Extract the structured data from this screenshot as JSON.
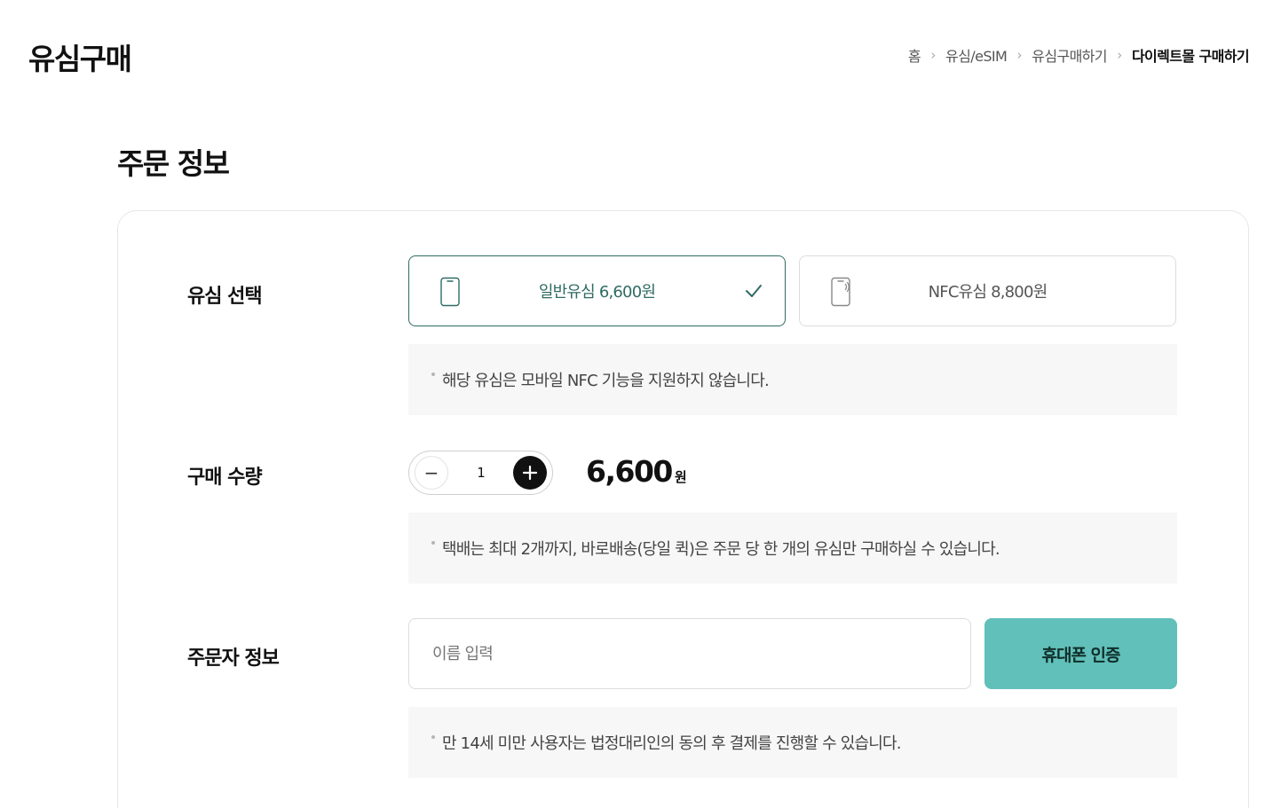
{
  "header": {
    "title": "유심구매"
  },
  "breadcrumb": {
    "items": [
      "홈",
      "유심/eSIM",
      "유심구매하기",
      "다이렉트몰 구매하기"
    ]
  },
  "section": {
    "title": "주문 정보"
  },
  "sim_selection": {
    "label": "유심 선택",
    "options": [
      {
        "label": "일반유심 6,600원",
        "selected": true,
        "icon": "phone-icon"
      },
      {
        "label": "NFC유심 8,800원",
        "selected": false,
        "icon": "nfc-phone-icon"
      }
    ],
    "notice": "해당 유심은 모바일 NFC 기능을 지원하지 않습니다."
  },
  "quantity": {
    "label": "구매 수량",
    "minus_label": "−",
    "value": "1",
    "price": "6,600",
    "unit": "원",
    "notice": "택배는 최대 2개까지, 바로배송(당일 퀵)은 주문 당 한 개의 유심만 구매하실 수 있습니다."
  },
  "orderer": {
    "label": "주문자 정보",
    "name_placeholder": "이름 입력",
    "name_value": "",
    "verify_button": "휴대폰 인증",
    "notice": "만 14세 미만 사용자는 법정대리인의 동의 후 결제를 진행할 수 있습니다."
  },
  "colors": {
    "accent": "#2f6b64",
    "button_bg": "#61c0b9",
    "notice_bg": "#f7f7f7"
  }
}
